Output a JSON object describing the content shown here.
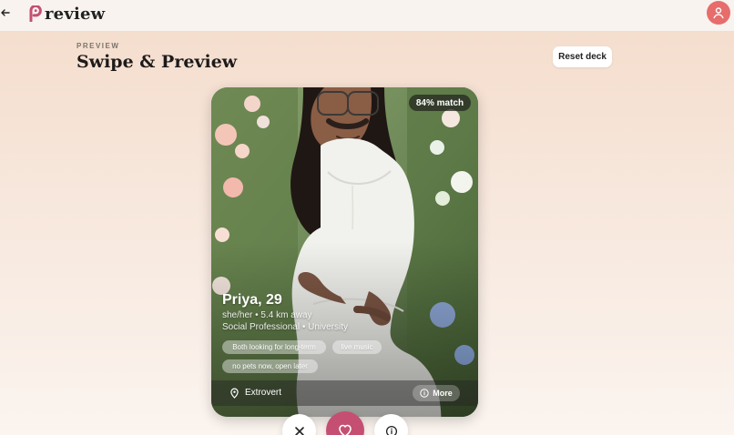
{
  "header": {
    "back_icon": "arrow-left-icon",
    "brand_name": "review",
    "avatar_icon": "user-icon",
    "colors": {
      "topbar_bg": "#f8f3ef",
      "brand": "#c54f72",
      "avatar": "#e66d6b"
    }
  },
  "page": {
    "eyebrow": "PREVIEW",
    "title": "Swipe & Preview",
    "reset_label": "Reset deck"
  },
  "card": {
    "match": "84% match",
    "name_age": "Priya, 29",
    "distance_line": "she/her • 5.4 km away",
    "job_line": "Social Professional • University",
    "chips": [
      "Both looking for long-term",
      "live music",
      "no pets now, open later"
    ],
    "trait": "Extrovert",
    "more_label": "More",
    "trait_icon": "location-pin-icon",
    "more_icon": "info-icon"
  },
  "actions": {
    "pass_icon": "close-icon",
    "like_icon": "heart-icon",
    "info_icon": "info-icon"
  }
}
